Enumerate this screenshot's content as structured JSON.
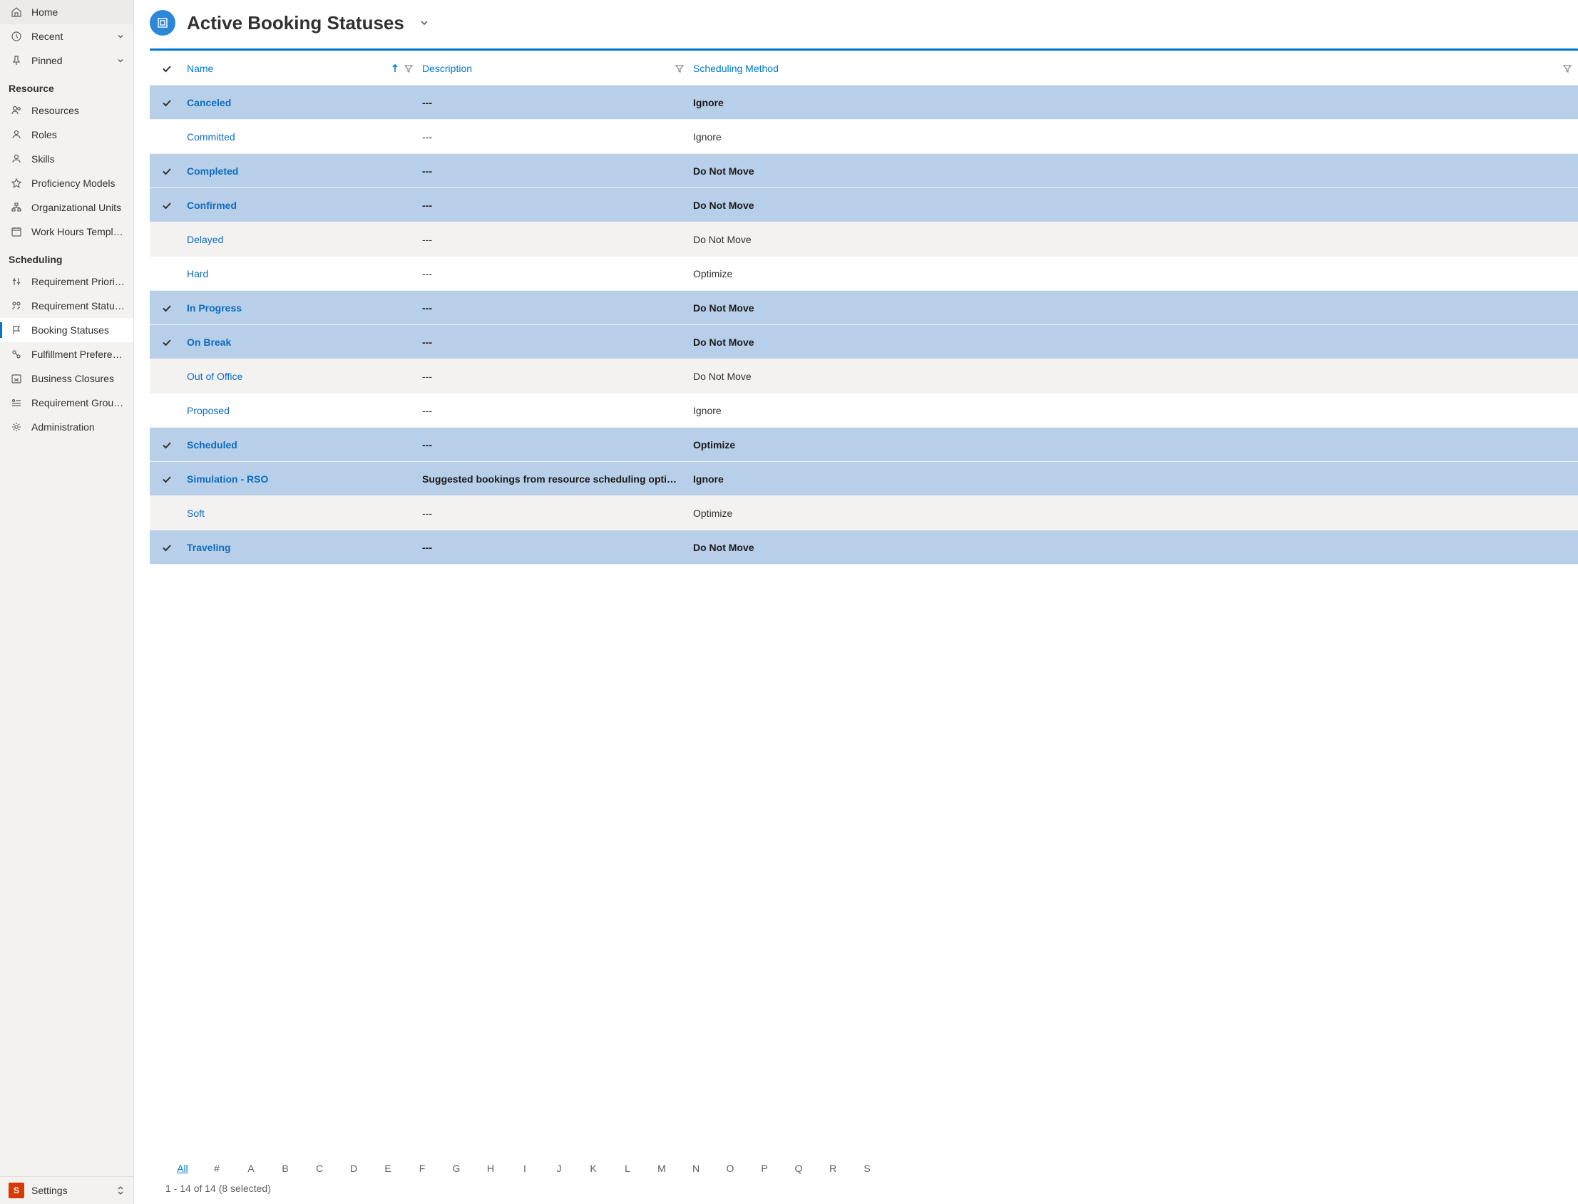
{
  "sidebar": {
    "top_items": [
      {
        "label": "Home"
      },
      {
        "label": "Recent",
        "expandable": true
      },
      {
        "label": "Pinned",
        "expandable": true
      }
    ],
    "groups": [
      {
        "label": "Resource",
        "items": [
          {
            "label": "Resources"
          },
          {
            "label": "Roles"
          },
          {
            "label": "Skills"
          },
          {
            "label": "Proficiency Models"
          },
          {
            "label": "Organizational Units"
          },
          {
            "label": "Work Hours Templates"
          }
        ]
      },
      {
        "label": "Scheduling",
        "items": [
          {
            "label": "Requirement Priorities"
          },
          {
            "label": "Requirement Statuses"
          },
          {
            "label": "Booking Statuses",
            "active": true
          },
          {
            "label": "Fulfillment Preferences"
          },
          {
            "label": "Business Closures"
          },
          {
            "label": "Requirement Group ..."
          },
          {
            "label": "Administration"
          }
        ]
      }
    ],
    "footer": {
      "badge": "S",
      "label": "Settings"
    }
  },
  "header": {
    "title": "Active Booking Statuses"
  },
  "grid": {
    "columns": {
      "name": "Name",
      "description": "Description",
      "scheduling_method": "Scheduling Method"
    },
    "rows": [
      {
        "selected": true,
        "alt": false,
        "name": "Canceled",
        "description": "---",
        "sched": "Ignore"
      },
      {
        "selected": false,
        "alt": false,
        "name": "Committed",
        "description": "---",
        "sched": "Ignore"
      },
      {
        "selected": true,
        "alt": false,
        "name": "Completed",
        "description": "---",
        "sched": "Do Not Move"
      },
      {
        "selected": true,
        "alt": false,
        "name": "Confirmed",
        "description": "---",
        "sched": "Do Not Move"
      },
      {
        "selected": false,
        "alt": true,
        "name": "Delayed",
        "description": "---",
        "sched": "Do Not Move"
      },
      {
        "selected": false,
        "alt": false,
        "name": "Hard",
        "description": "---",
        "sched": "Optimize"
      },
      {
        "selected": true,
        "alt": false,
        "name": "In Progress",
        "description": "---",
        "sched": "Do Not Move"
      },
      {
        "selected": true,
        "alt": false,
        "name": "On Break",
        "description": "---",
        "sched": "Do Not Move"
      },
      {
        "selected": false,
        "alt": true,
        "name": "Out of Office",
        "description": "---",
        "sched": "Do Not Move"
      },
      {
        "selected": false,
        "alt": false,
        "name": "Proposed",
        "description": "---",
        "sched": "Ignore"
      },
      {
        "selected": true,
        "alt": false,
        "name": "Scheduled",
        "description": "---",
        "sched": "Optimize"
      },
      {
        "selected": true,
        "alt": false,
        "name": "Simulation - RSO",
        "description": "Suggested bookings from resource scheduling optimiz...",
        "sched": "Ignore"
      },
      {
        "selected": false,
        "alt": true,
        "name": "Soft",
        "description": "---",
        "sched": "Optimize"
      },
      {
        "selected": true,
        "alt": false,
        "name": "Traveling",
        "description": "---",
        "sched": "Do Not Move"
      }
    ]
  },
  "alpha": {
    "active": "All",
    "entries": [
      "All",
      "#",
      "A",
      "B",
      "C",
      "D",
      "E",
      "F",
      "G",
      "H",
      "I",
      "J",
      "K",
      "L",
      "M",
      "N",
      "O",
      "P",
      "Q",
      "R",
      "S"
    ]
  },
  "footer_status": "1 - 14 of 14 (8 selected)"
}
